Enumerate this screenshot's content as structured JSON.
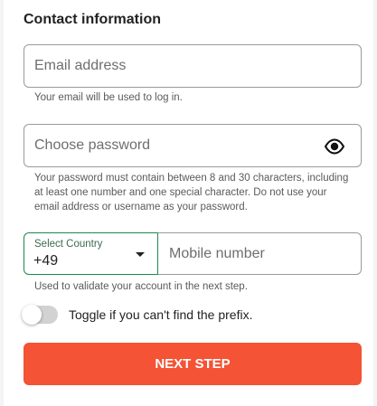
{
  "section": {
    "title": "Contact information"
  },
  "email": {
    "placeholder": "Email address",
    "value": "",
    "help": "Your email will be used to log in."
  },
  "password": {
    "placeholder": "Choose password",
    "value": "",
    "toggle_icon": "eye-icon",
    "help": "Your password must contain between 8 and 30 characters, including at least one number and one special character. Do not use your email address or username as your password."
  },
  "phone": {
    "country_label": "Select Country",
    "country_value": "+49",
    "mobile_placeholder": "Mobile number",
    "mobile_value": "",
    "help": "Used to validate your account in the next step."
  },
  "prefix_toggle": {
    "label": "Toggle if you can't find the prefix.",
    "on": false
  },
  "actions": {
    "next_label": "NEXT STEP"
  },
  "colors": {
    "accent": "#f45335",
    "focus_border": "#1a8a4c",
    "toggle_off": "#d2d2d2"
  }
}
